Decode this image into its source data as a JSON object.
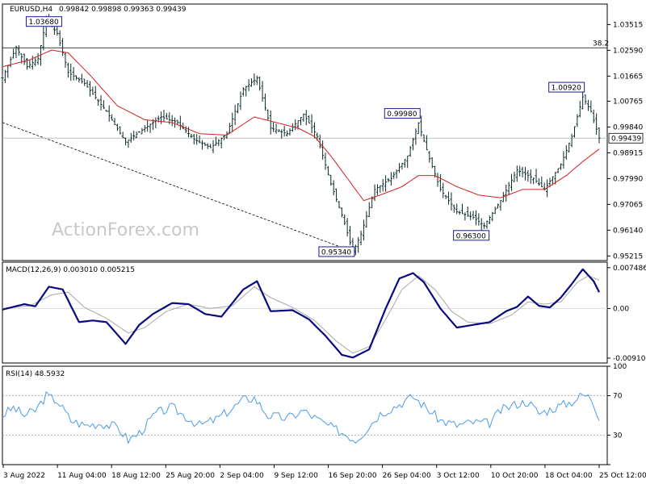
{
  "header": {
    "symbol": "EURUSD,H4",
    "ohlc": "0.99842 0.99898 0.99363 0.99439"
  },
  "watermark": "ActionForex.com",
  "colors": {
    "bars": "#0b2a2a",
    "ma": "#d42020",
    "macd": "#0a0a80",
    "signal": "#a8a8a8",
    "rsi": "#4d9be6",
    "box": "#1a1a99",
    "grid": "#c0c0c0"
  },
  "chart_data": [
    {
      "type": "ohlc",
      "name": "price",
      "ylim": [
        0.9505,
        1.0425
      ],
      "y_ticks": [
        "1.03515",
        "1.02590",
        "1.01665",
        "1.00765",
        "0.99840",
        "0.98915",
        "0.97990",
        "0.97065",
        "0.96140",
        "0.95215"
      ],
      "x_ticks": [
        "3 Aug 2022",
        "11 Aug 04:00",
        "18 Aug 12:00",
        "25 Aug 20:00",
        "2 Sep 04:00",
        "9 Sep 12:00",
        "16 Sep 20:00",
        "26 Sep 04:00",
        "3 Oct 12:00",
        "10 Oct 20:00",
        "18 Oct 04:00",
        "25 Oct 12:00"
      ],
      "close_path": [
        [
          0,
          1.016
        ],
        [
          5,
          1.027
        ],
        [
          9,
          1.02
        ],
        [
          13,
          1.023
        ],
        [
          16,
          1.0368
        ],
        [
          20,
          1.032
        ],
        [
          24,
          1.018
        ],
        [
          30,
          1.014
        ],
        [
          38,
          1.004
        ],
        [
          45,
          0.993
        ],
        [
          52,
          0.998
        ],
        [
          58,
          1.002
        ],
        [
          64,
          1.0
        ],
        [
          70,
          0.994
        ],
        [
          76,
          0.991
        ],
        [
          82,
          0.996
        ],
        [
          88,
          1.012
        ],
        [
          93,
          1.016
        ],
        [
          98,
          0.998
        ],
        [
          104,
          0.996
        ],
        [
          110,
          1.003
        ],
        [
          115,
          0.995
        ],
        [
          120,
          0.978
        ],
        [
          125,
          0.964
        ],
        [
          128,
          0.9534
        ],
        [
          131,
          0.96
        ],
        [
          136,
          0.976
        ],
        [
          142,
          0.98
        ],
        [
          148,
          0.988
        ],
        [
          152,
          0.9998
        ],
        [
          156,
          0.987
        ],
        [
          160,
          0.976
        ],
        [
          166,
          0.968
        ],
        [
          172,
          0.966
        ],
        [
          176,
          0.963
        ],
        [
          182,
          0.972
        ],
        [
          188,
          0.983
        ],
        [
          194,
          0.98
        ],
        [
          198,
          0.976
        ],
        [
          204,
          0.985
        ],
        [
          208,
          0.995
        ],
        [
          212,
          1.0092
        ],
        [
          215,
          1.004
        ],
        [
          218,
          0.9944
        ]
      ],
      "ma_path": [
        [
          0,
          1.02
        ],
        [
          10,
          1.0225
        ],
        [
          18,
          1.026
        ],
        [
          24,
          1.025
        ],
        [
          32,
          1.017
        ],
        [
          42,
          1.006
        ],
        [
          52,
          1.001
        ],
        [
          62,
          1.0
        ],
        [
          72,
          0.996
        ],
        [
          82,
          0.9955
        ],
        [
          92,
          1.002
        ],
        [
          100,
          1.0
        ],
        [
          108,
          0.998
        ],
        [
          114,
          0.995
        ],
        [
          120,
          0.988
        ],
        [
          126,
          0.98
        ],
        [
          132,
          0.972
        ],
        [
          138,
          0.974
        ],
        [
          146,
          0.977
        ],
        [
          152,
          0.981
        ],
        [
          158,
          0.981
        ],
        [
          166,
          0.977
        ],
        [
          174,
          0.974
        ],
        [
          182,
          0.973
        ],
        [
          190,
          0.976
        ],
        [
          198,
          0.976
        ],
        [
          206,
          0.981
        ],
        [
          212,
          0.986
        ],
        [
          218,
          0.9905
        ]
      ],
      "hline": {
        "value": 1.0268,
        "label": "38.2"
      },
      "trendline": [
        [
          0,
          1.0
        ],
        [
          129,
          0.9534
        ]
      ],
      "price_line": 0.99439,
      "current_label": "0.99439",
      "annotations": [
        {
          "text": "1.03680",
          "x": 14,
          "y": 1.0368
        },
        {
          "text": "0.95340",
          "x": 128,
          "y": 0.9534
        },
        {
          "text": "0.99980",
          "x": 152,
          "y": 0.9998
        },
        {
          "text": "0.96300",
          "x": 176,
          "y": 0.963
        },
        {
          "text": "1.00920",
          "x": 212,
          "y": 1.0092
        }
      ]
    },
    {
      "type": "line",
      "name": "macd",
      "label": "MACD(12,26,9) 0.003010 0.005215",
      "ylim": [
        -0.01,
        0.0085
      ],
      "y_ticks": [
        "0.007486",
        "0.00",
        "-0.009104"
      ],
      "series": [
        {
          "values": [
            [
              0,
              -0.0002
            ],
            [
              8,
              0.0008
            ],
            [
              12,
              0.0004
            ],
            [
              17,
              0.004
            ],
            [
              22,
              0.0035
            ],
            [
              28,
              -0.0025
            ],
            [
              33,
              -0.0022
            ],
            [
              38,
              -0.0025
            ],
            [
              45,
              -0.0065
            ],
            [
              50,
              -0.003
            ],
            [
              55,
              -0.001
            ],
            [
              62,
              0.001
            ],
            [
              68,
              0.0008
            ],
            [
              74,
              -0.001
            ],
            [
              80,
              -0.0015
            ],
            [
              88,
              0.0035
            ],
            [
              93,
              0.005
            ],
            [
              98,
              -0.0005
            ],
            [
              106,
              -0.0003
            ],
            [
              112,
              -0.002
            ],
            [
              118,
              -0.005
            ],
            [
              124,
              -0.0085
            ],
            [
              128,
              -0.009
            ],
            [
              134,
              -0.0075
            ],
            [
              140,
              0.0
            ],
            [
              145,
              0.0055
            ],
            [
              150,
              0.0065
            ],
            [
              154,
              0.0048
            ],
            [
              160,
              0.0
            ],
            [
              166,
              -0.0035
            ],
            [
              172,
              -0.003
            ],
            [
              178,
              -0.0025
            ],
            [
              184,
              -0.0005
            ],
            [
              188,
              0.0003
            ],
            [
              192,
              0.0022
            ],
            [
              196,
              0.0005
            ],
            [
              200,
              0.0002
            ],
            [
              204,
              0.002
            ],
            [
              208,
              0.0045
            ],
            [
              212,
              0.0072
            ],
            [
              216,
              0.005
            ],
            [
              218,
              0.003
            ]
          ]
        },
        {
          "values": [
            [
              0,
              0.0
            ],
            [
              10,
              0.0005
            ],
            [
              18,
              0.0025
            ],
            [
              24,
              0.003
            ],
            [
              30,
              0.0002
            ],
            [
              38,
              -0.0018
            ],
            [
              46,
              -0.0045
            ],
            [
              52,
              -0.0035
            ],
            [
              60,
              -0.0005
            ],
            [
              68,
              0.0008
            ],
            [
              76,
              0.0
            ],
            [
              84,
              0.0005
            ],
            [
              92,
              0.004
            ],
            [
              98,
              0.002
            ],
            [
              106,
              0.0002
            ],
            [
              114,
              -0.0022
            ],
            [
              122,
              -0.006
            ],
            [
              128,
              -0.0082
            ],
            [
              134,
              -0.007
            ],
            [
              140,
              -0.002
            ],
            [
              146,
              0.0035
            ],
            [
              152,
              0.006
            ],
            [
              158,
              0.0035
            ],
            [
              164,
              -0.0005
            ],
            [
              170,
              -0.0025
            ],
            [
              178,
              -0.0028
            ],
            [
              186,
              -0.0012
            ],
            [
              192,
              0.0012
            ],
            [
              198,
              0.0008
            ],
            [
              204,
              0.0012
            ],
            [
              210,
              0.0048
            ],
            [
              214,
              0.006
            ],
            [
              218,
              0.0052
            ]
          ]
        }
      ]
    },
    {
      "type": "line",
      "name": "rsi",
      "label": "RSI(14) 48.5932",
      "ylim": [
        0,
        100
      ],
      "y_ticks": [
        "100",
        "70",
        "30",
        "0"
      ],
      "levels": [
        70,
        30
      ],
      "series": [
        {
          "values": [
            [
              0,
              50
            ],
            [
              4,
              58
            ],
            [
              8,
              50
            ],
            [
              12,
              55
            ],
            [
              16,
              70
            ],
            [
              20,
              65
            ],
            [
              25,
              45
            ],
            [
              30,
              40
            ],
            [
              36,
              42
            ],
            [
              42,
              38
            ],
            [
              46,
              25
            ],
            [
              50,
              32
            ],
            [
              56,
              52
            ],
            [
              62,
              58
            ],
            [
              68,
              47
            ],
            [
              72,
              40
            ],
            [
              78,
              46
            ],
            [
              84,
              57
            ],
            [
              88,
              66
            ],
            [
              92,
              68
            ],
            [
              97,
              50
            ],
            [
              104,
              47
            ],
            [
              110,
              55
            ],
            [
              115,
              46
            ],
            [
              120,
              38
            ],
            [
              126,
              30
            ],
            [
              129,
              25
            ],
            [
              132,
              33
            ],
            [
              138,
              52
            ],
            [
              144,
              60
            ],
            [
              150,
              69
            ],
            [
              154,
              60
            ],
            [
              160,
              45
            ],
            [
              166,
              40
            ],
            [
              172,
              43
            ],
            [
              178,
              42
            ],
            [
              182,
              55
            ],
            [
              188,
              62
            ],
            [
              192,
              64
            ],
            [
              196,
              52
            ],
            [
              202,
              58
            ],
            [
              208,
              64
            ],
            [
              212,
              71
            ],
            [
              215,
              68
            ],
            [
              218,
              49
            ]
          ]
        }
      ]
    }
  ]
}
